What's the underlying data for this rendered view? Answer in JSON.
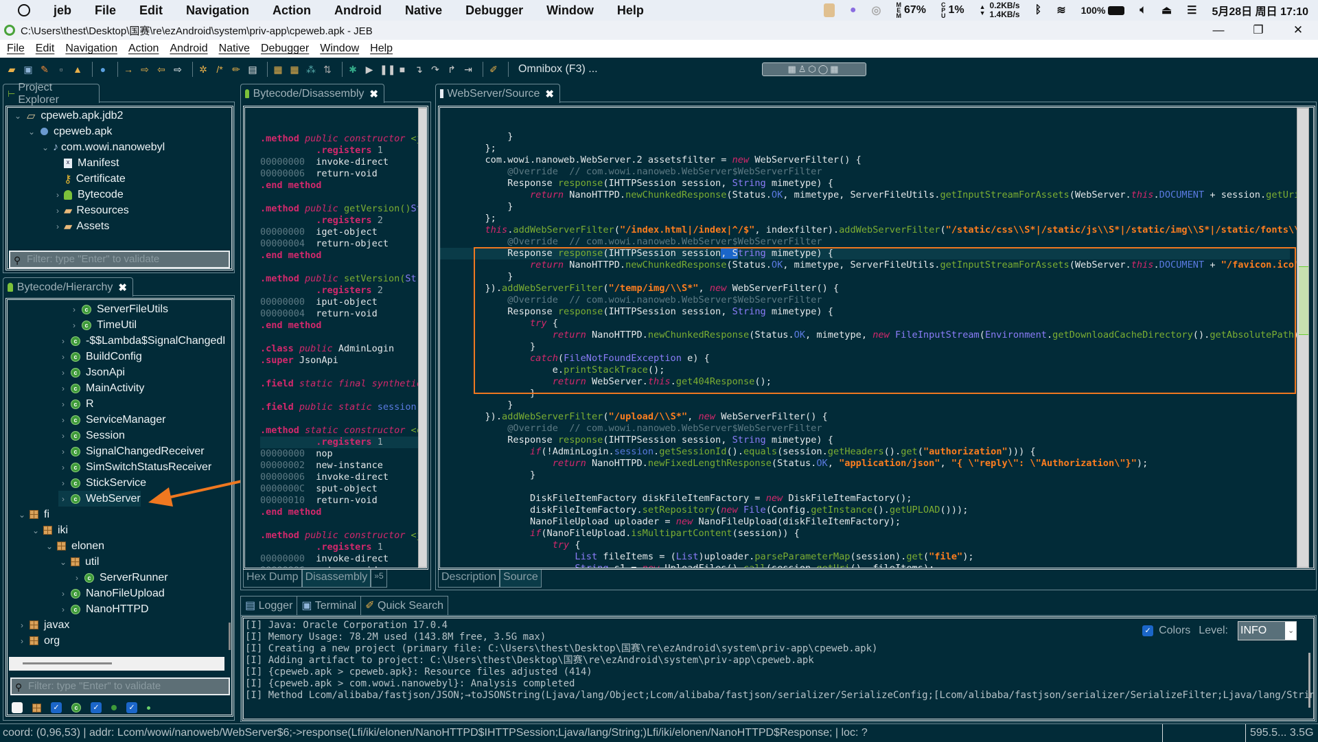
{
  "system_bar": {
    "app_name": "jeb",
    "menu": [
      "File",
      "Edit",
      "Navigation",
      "Action",
      "Android",
      "Native",
      "Debugger",
      "Window",
      "Help"
    ],
    "mem_label": "MEM",
    "mem_value": "67%",
    "cpu_label": "CPU",
    "cpu_value": "1%",
    "net_up": "0.2KB/s",
    "net_down": "1.4KB/s",
    "battery": "100%",
    "datetime": "5月28日 周日 17:10"
  },
  "window": {
    "title": "C:\\Users\\thest\\Desktop\\国赛\\re\\ezAndroid\\system\\priv-app\\cpeweb.apk - JEB",
    "minimize": "—",
    "restore": "❐",
    "close": "✕"
  },
  "app_menu": [
    "File",
    "Edit",
    "Navigation",
    "Action",
    "Android",
    "Native",
    "Debugger",
    "Window",
    "Help"
  ],
  "toolbar": {
    "omnibox_placeholder": "Omnibox (F3) ...",
    "perspective_icons": "▦♙⬡◯▦"
  },
  "project_explorer": {
    "tab_label": "Project Explorer",
    "items": [
      {
        "label": "cpeweb.apk.jdb2",
        "icon": "folder-open-icon"
      },
      {
        "label": "cpeweb.apk",
        "icon": "apk-icon"
      },
      {
        "label": "com.wowi.nanowebyl",
        "icon": "package-icon"
      },
      {
        "label": "Manifest",
        "icon": "xml-file-icon"
      },
      {
        "label": "Certificate",
        "icon": "key-icon"
      },
      {
        "label": "Bytecode",
        "icon": "android-icon"
      },
      {
        "label": "Resources",
        "icon": "folder-icon"
      },
      {
        "label": "Assets",
        "icon": "folder-icon"
      }
    ],
    "filter_placeholder": "Filter: type \"Enter\" to validate"
  },
  "hierarchy": {
    "tab_label": "Bytecode/Hierarchy",
    "items": [
      {
        "label": "ServerFileUtils",
        "type": "class"
      },
      {
        "label": "TimeUtil",
        "type": "class"
      },
      {
        "label": "-$$Lambda$SignalChangedR",
        "type": "class"
      },
      {
        "label": "BuildConfig",
        "type": "class"
      },
      {
        "label": "JsonApi",
        "type": "class"
      },
      {
        "label": "MainActivity",
        "type": "class"
      },
      {
        "label": "R",
        "type": "class"
      },
      {
        "label": "ServiceManager",
        "type": "class"
      },
      {
        "label": "Session",
        "type": "class"
      },
      {
        "label": "SignalChangedReceiver",
        "type": "class"
      },
      {
        "label": "SimSwitchStatusReceiver",
        "type": "class"
      },
      {
        "label": "StickService",
        "type": "class"
      },
      {
        "label": "WebServer",
        "type": "class"
      },
      {
        "label": "fi",
        "type": "package"
      },
      {
        "label": "iki",
        "type": "package"
      },
      {
        "label": "elonen",
        "type": "package"
      },
      {
        "label": "util",
        "type": "package"
      },
      {
        "label": "ServerRunner",
        "type": "class"
      },
      {
        "label": "NanoFileUpload",
        "type": "class"
      },
      {
        "label": "NanoHTTPD",
        "type": "class"
      },
      {
        "label": "javax",
        "type": "package"
      },
      {
        "label": "org",
        "type": "package"
      }
    ],
    "filter_placeholder": "Filter: type \"Enter\" to validate"
  },
  "disassembly": {
    "tab_label": "Bytecode/Disassembly",
    "bottom_tabs": [
      "Hex Dump",
      "Disassembly",
      "»5"
    ]
  },
  "source": {
    "tab_label": "WebServer/Source",
    "bottom_tabs": [
      "Description",
      "Source"
    ]
  },
  "logger": {
    "tabs": [
      "Logger",
      "Terminal",
      "Quick Search"
    ],
    "colors_label": "Colors",
    "level_label": "Level:",
    "level_value": "INFO",
    "lines": [
      "[I] Java: Oracle Corporation 17.0.4",
      "[I] Memory Usage: 78.2M used (143.8M free, 3.5G max)",
      "[I] Creating a new project (primary file: C:\\Users\\thest\\Desktop\\国赛\\re\\ezAndroid\\system\\priv-app\\cpeweb.apk)",
      "[I] Adding artifact to project: C:\\Users\\thest\\Desktop\\国赛\\re\\ezAndroid\\system\\priv-app\\cpeweb.apk",
      "[I] {cpeweb.apk > cpeweb.apk}: Resource files adjusted (414)",
      "[I] {cpeweb.apk > com.wowi.nanowebyl}: Analysis completed",
      "[I] Method Lcom/alibaba/fastjson/JSON;→toJSONString(Ljava/lang/Object;Lcom/alibaba/fastjson/serializer/SerializeConfig;[Lcom/alibaba/fastjson/serializer/SerializeFilter;Ljava/lang/String;I[Lcom"
    ]
  },
  "status_bar": {
    "text": "coord: (0,96,53) | addr: Lcom/wowi/nanoweb/WebServer$6;->response(Lfi/iki/elonen/NanoHTTPD$IHTTPSession;Ljava/lang/String;)Lfi/iki/elonen/NanoHTTPD$Response; | loc: ?",
    "memory": "595.5... 3.5G"
  },
  "colors": {
    "background": "#022b38",
    "keyword": "#d4286c",
    "string": "#ff7e1f",
    "method": "#7cae32",
    "type": "#8b7cf8",
    "highlight_box": "#f07820"
  }
}
